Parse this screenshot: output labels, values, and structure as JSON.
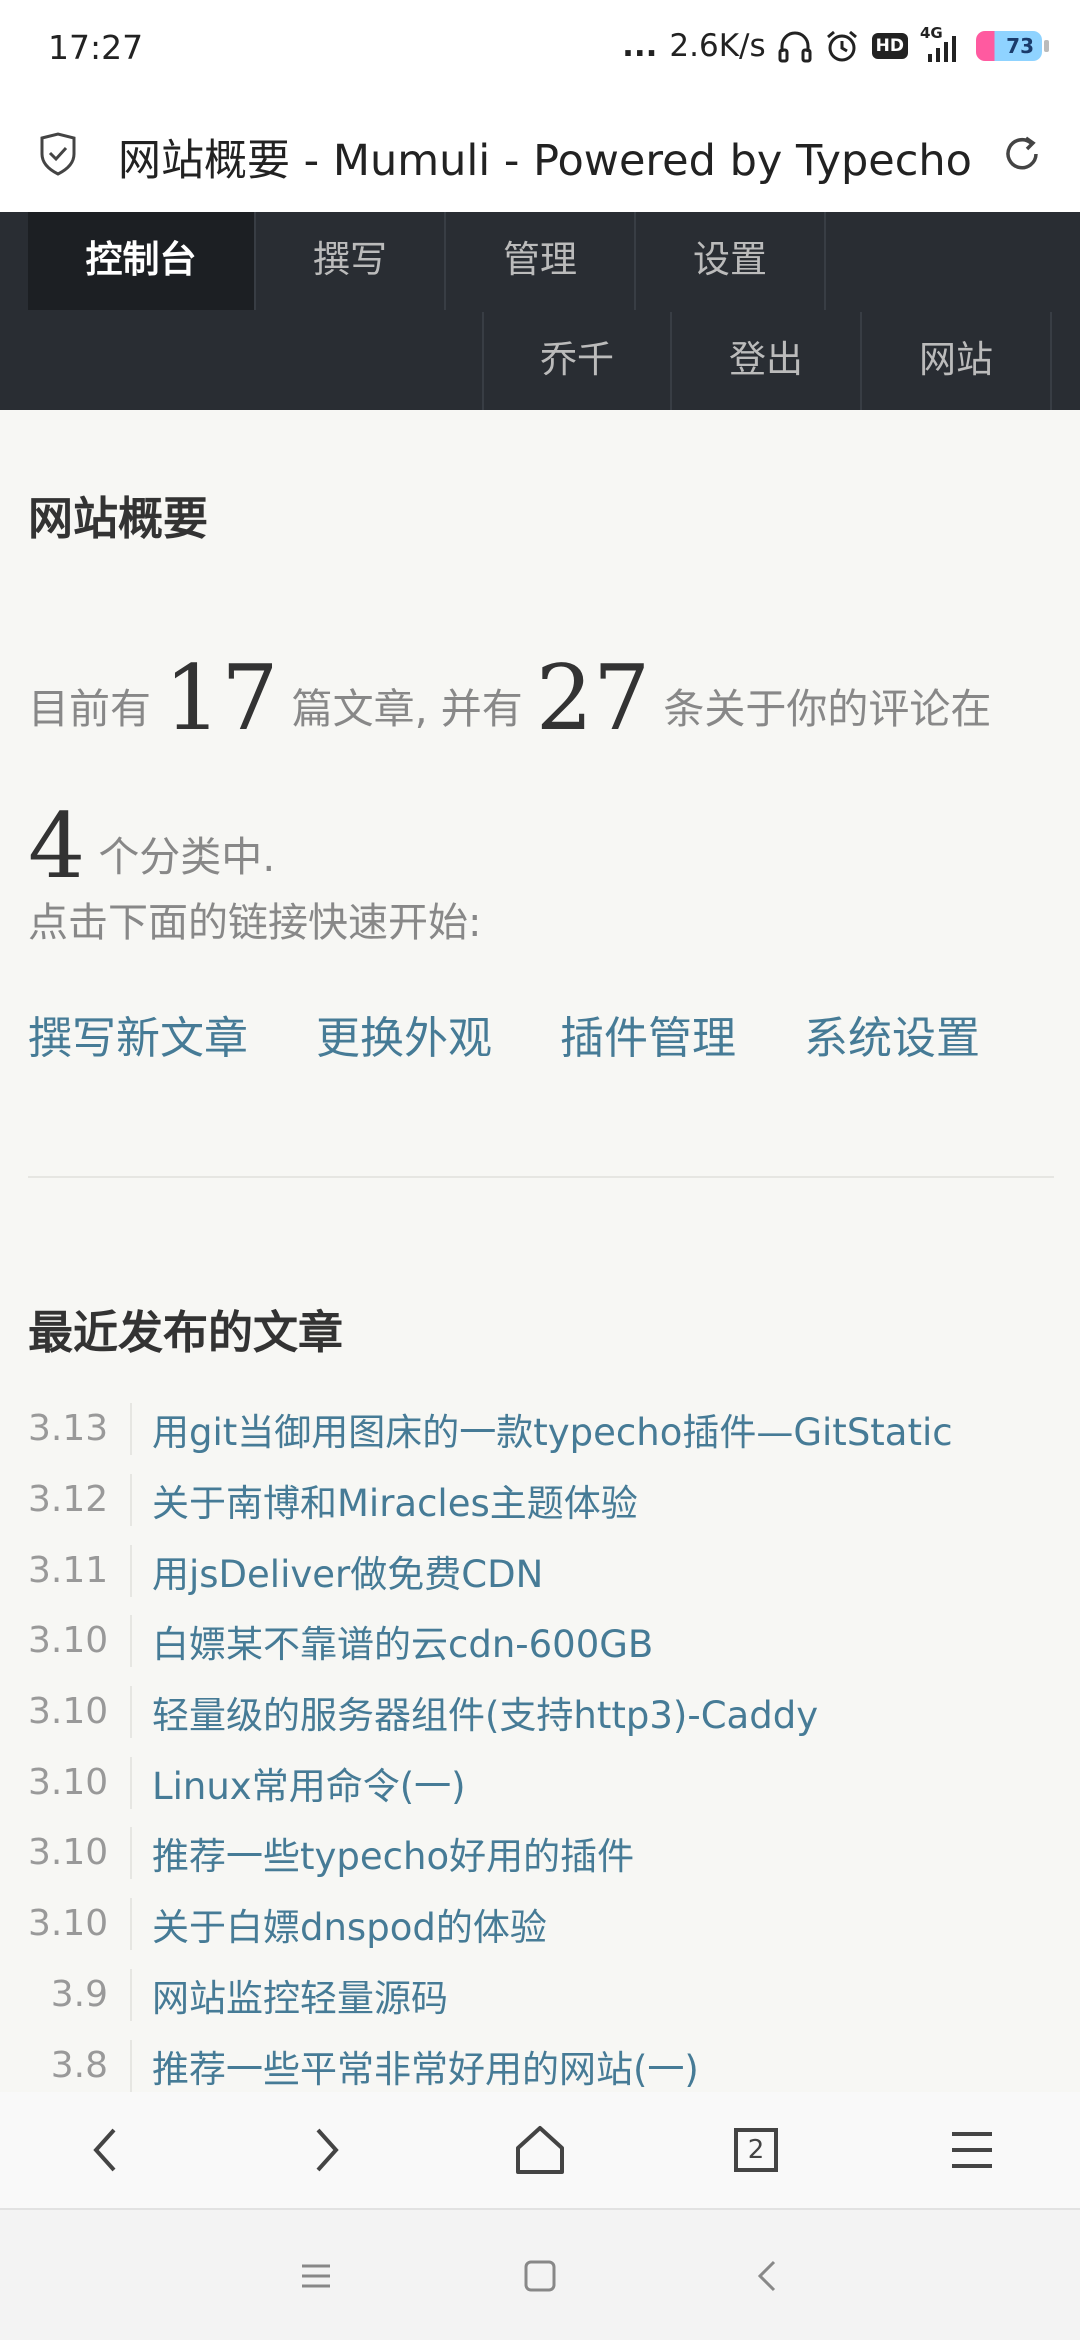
{
  "status_bar": {
    "time": "17:27",
    "dots": "...",
    "speed": "2.6K/s",
    "hd": "HD",
    "network": "4G",
    "battery": "73"
  },
  "browser": {
    "title": "网站概要 - Mumuli - Powered by Typecho",
    "tab_count": "2"
  },
  "nav": {
    "items": [
      "控制台",
      "撰写",
      "管理",
      "设置"
    ],
    "right_items": [
      "乔千",
      "登出",
      "网站"
    ]
  },
  "overview": {
    "heading": "网站概要",
    "text1": "目前有",
    "posts_count": "17",
    "text2": "篇文章, 并有",
    "comments_count": "27",
    "text3": "条关于你的评论在",
    "categories_count": "4",
    "text4": "个分类中.",
    "hint": "点击下面的链接快速开始:",
    "links": [
      "撰写新文章",
      "更换外观",
      "插件管理",
      "系统设置"
    ]
  },
  "recent": {
    "heading": "最近发布的文章",
    "posts": [
      {
        "date": "3.13",
        "title": "用git当御用图床的一款typecho插件—GitStatic"
      },
      {
        "date": "3.12",
        "title": "关于南博和Miracles主题体验"
      },
      {
        "date": "3.11",
        "title": "用jsDeliver做免费CDN"
      },
      {
        "date": "3.10",
        "title": "白嫖某不靠谱的云cdn-600GB"
      },
      {
        "date": "3.10",
        "title": "轻量级的服务器组件(支持http3)-Caddy"
      },
      {
        "date": "3.10",
        "title": "Linux常用命令(一)"
      },
      {
        "date": "3.10",
        "title": "推荐一些typecho好用的插件"
      },
      {
        "date": "3.10",
        "title": "关于白嫖dnspod的体验"
      },
      {
        "date": "3.9",
        "title": "网站监控轻量源码"
      },
      {
        "date": "3.8",
        "title": "推荐一些平常非常好用的网站(一)"
      }
    ]
  },
  "colors": {
    "link": "#467b96",
    "nav_bg": "#292d33",
    "nav_active_bg": "#1c1f23",
    "page_bg": "#f7f7f4"
  }
}
